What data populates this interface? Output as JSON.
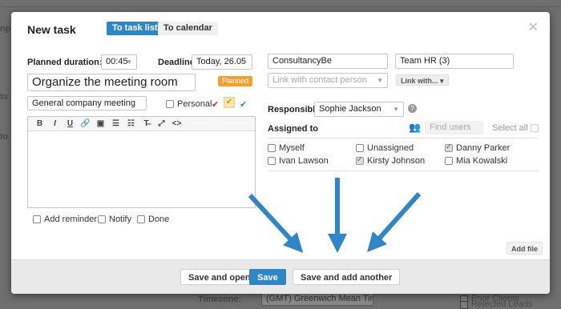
{
  "background": {
    "fragments": [
      "np",
      "ts",
      "to"
    ],
    "timezone_label": "Timezone:",
    "timezone_value": "(GMT) Greenwich Mean Time : D",
    "right_items": [
      "Prior Clients",
      "Rejected Leads"
    ]
  },
  "dialog": {
    "title": "New task",
    "tabs": {
      "task_list": "To task list",
      "calendar": "To calendar"
    },
    "close_glyph": "✕"
  },
  "planned_duration": {
    "label": "Planned duration:",
    "value": "00:45"
  },
  "deadline": {
    "label": "Deadline:",
    "value": "Today, 26.05"
  },
  "task": {
    "name": "Organize the meeting room",
    "status_badge": "Planned",
    "category": "General company meeting",
    "personal_label": "Personal"
  },
  "editor_toolbar": [
    "B",
    "I",
    "U",
    "🔗",
    "▣",
    "☰",
    "☷",
    "T̶",
    "⤢",
    "<>"
  ],
  "options": {
    "add_reminder": "Add reminder",
    "notify": "Notify",
    "done": "Done"
  },
  "crm": {
    "company": "ConsultancyBe",
    "team": "Team HR (3)",
    "contact_placeholder": "Link with contact person",
    "link_with": "Link with..."
  },
  "responsible": {
    "label": "Responsible:",
    "value": "Sophie Jackson",
    "help": "?"
  },
  "assigned": {
    "label": "Assigned to",
    "find_placeholder": "Find users",
    "select_all": "Select all",
    "users": [
      {
        "name": "Myself",
        "checked": false
      },
      {
        "name": "Unassigned",
        "checked": false
      },
      {
        "name": "Danny Parker",
        "checked": true
      },
      {
        "name": "Ivan Lawson",
        "checked": false
      },
      {
        "name": "Kirsty Johnson",
        "checked": true
      },
      {
        "name": "Mia Kowalski",
        "checked": false
      }
    ]
  },
  "add_file": "Add file",
  "footer": {
    "save_open": "Save and open",
    "save": "Save",
    "save_add": "Save and add another"
  },
  "colors": {
    "accent": "#2d86c5",
    "badge": "#f0a030",
    "arrow": "#2f86c6"
  }
}
